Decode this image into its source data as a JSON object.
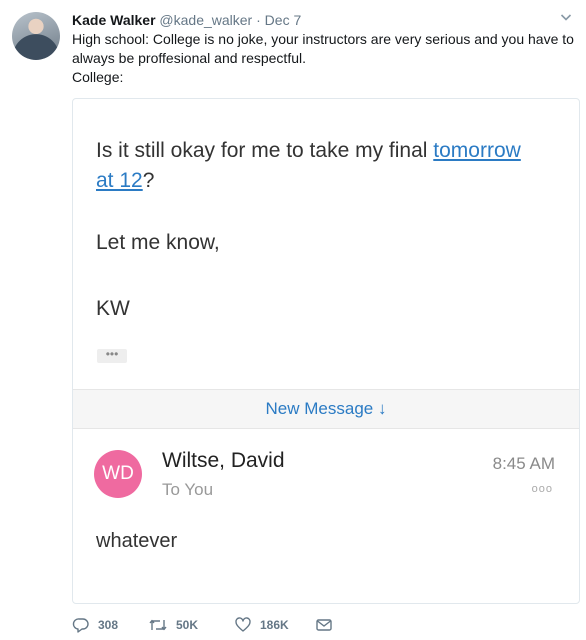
{
  "tweet": {
    "author_name": "Kade Walker",
    "author_handle": "@kade_walker",
    "separator": "·",
    "date": "Dec 7",
    "text_line1": "High school: College is no joke, your instructors are very serious and you have to",
    "text_line2": "always be proffesional and respectful.",
    "text_line3": "College:"
  },
  "email": {
    "line1_prefix": "Is it still okay for me to take my final ",
    "line1_link": "tomorrow",
    "line1_link2": "at 12",
    "line1_suffix": "?",
    "line2": "Let me know,",
    "line3": "KW",
    "collapsed_indicator": "•••",
    "new_message_label": "New Message ↓",
    "reply": {
      "avatar_initials": "WD",
      "sender": "Wiltse, David",
      "recipient": "To You",
      "time": "8:45 AM",
      "more": "ooo",
      "body": "whatever"
    }
  },
  "actions": {
    "replies": "308",
    "retweets": "50K",
    "likes": "186K"
  },
  "colors": {
    "link": "#2b7bc4",
    "avatar_pink": "#ef6aa0",
    "muted": "#657786"
  }
}
